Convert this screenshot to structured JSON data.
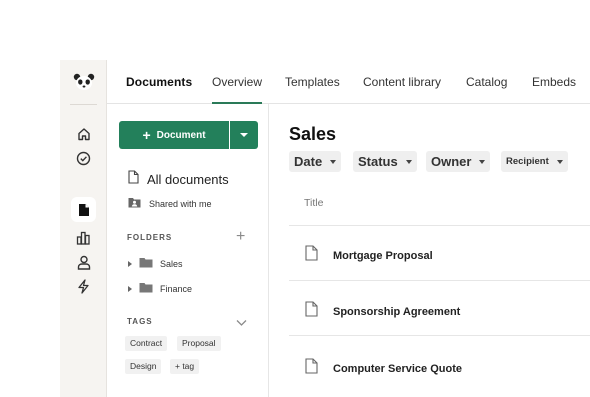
{
  "nav": {
    "brand": "Documents",
    "tabs": [
      {
        "label": "Overview",
        "active": true
      },
      {
        "label": "Templates",
        "active": false
      },
      {
        "label": "Content library",
        "active": false
      },
      {
        "label": "Catalog",
        "active": false
      },
      {
        "label": "Embeds",
        "active": false
      }
    ]
  },
  "rail": {
    "icons": [
      "panda-logo",
      "home-icon",
      "check-circle-icon",
      "document-icon",
      "bar-chart-icon",
      "person-icon",
      "lightning-icon"
    ],
    "active": "document-icon"
  },
  "sidebar": {
    "new_button_label": "Document",
    "all_documents": "All documents",
    "shared_with_me": "Shared with me",
    "folders_title": "FOLDERS",
    "folders": [
      {
        "label": "Sales"
      },
      {
        "label": "Finance"
      }
    ],
    "tags_title": "TAGS",
    "tags": [
      "Contract",
      "Proposal",
      "Design",
      "+ tag"
    ]
  },
  "main": {
    "title": "Sales",
    "filters": [
      "Date",
      "Status",
      "Owner",
      "Recipient"
    ],
    "column_title": "Title",
    "rows": [
      {
        "title": "Mortgage Proposal"
      },
      {
        "title": "Sponsorship Agreement"
      },
      {
        "title": "Computer Service Quote"
      }
    ]
  },
  "colors": {
    "accent": "#23805b",
    "rail_bg": "#f6f4f1",
    "filter_bg": "#efefef"
  }
}
